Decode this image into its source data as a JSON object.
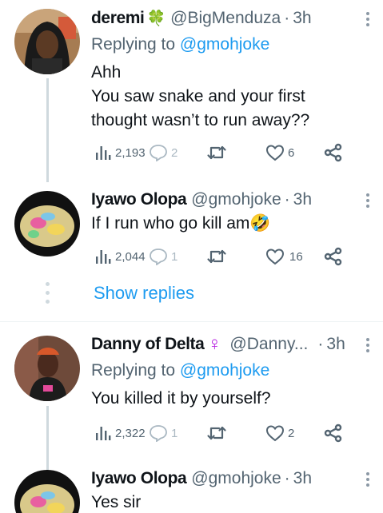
{
  "tweets": [
    {
      "name": "deremi",
      "name_emoji": "🍀",
      "handle": "@BigMenduza",
      "time": "3h",
      "replying_prefix": "Replying to ",
      "replying_to": "@gmohjoke",
      "text_lines": [
        "Ahh",
        "You saw snake and your first",
        "thought wasn’t to run away??"
      ],
      "views": "2,193",
      "replies": "2",
      "retweets": "",
      "likes": "6"
    },
    {
      "name": "Iyawo Olopa",
      "handle": "@gmohjoke",
      "time": "3h",
      "text": "If I run who go kill am",
      "text_emoji": "🤣",
      "views": "2,044",
      "replies": "1",
      "retweets": "",
      "likes": "16"
    },
    {
      "name": "Danny of Delta",
      "name_emoji": "♀",
      "handle": "@Danny...",
      "time": "3h",
      "replying_prefix": "Replying to ",
      "replying_to": "@gmohjoke",
      "text": "You killed it by yourself?",
      "views": "2,322",
      "replies": "1",
      "retweets": "",
      "likes": "2"
    },
    {
      "name": "Iyawo Olopa",
      "handle": "@gmohjoke",
      "time": "3h",
      "text": "Yes sir"
    }
  ],
  "show_replies": "Show replies",
  "separator": "·",
  "colors": {
    "accent": "#1d9bf0",
    "secondary_text": "#536471",
    "thread_line": "#cfd9de",
    "female_sign": "#b620e0"
  },
  "icons": [
    "views-icon",
    "reply-icon",
    "retweet-icon",
    "like-icon",
    "share-icon",
    "more-icon"
  ]
}
